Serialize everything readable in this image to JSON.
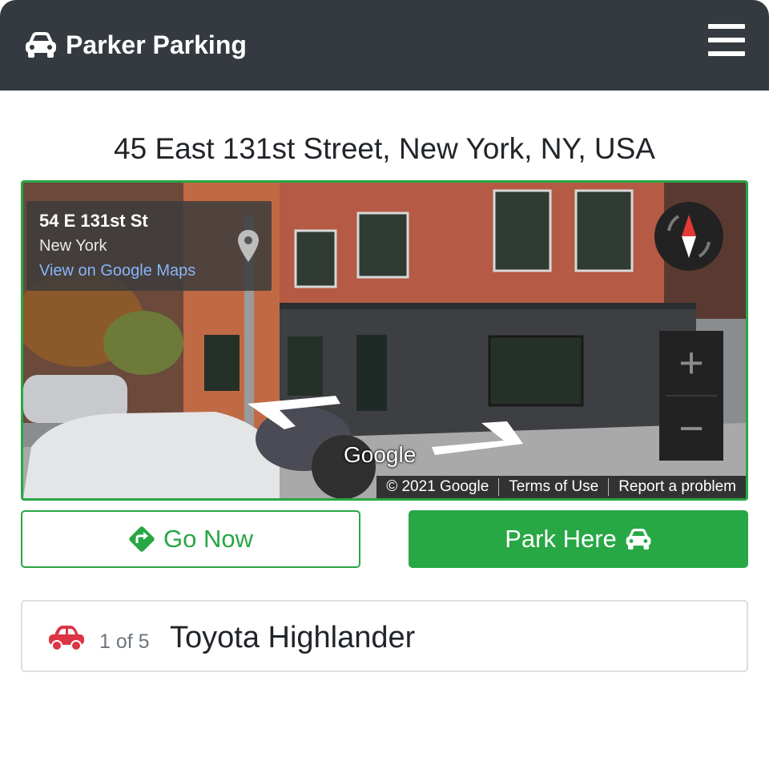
{
  "navbar": {
    "brand": "Parker Parking",
    "brand_icon": "car-icon",
    "menu_icon": "hamburger-icon",
    "background": "#343a40"
  },
  "location": {
    "address": "45 East 131st Street, New York, NY, USA"
  },
  "street_view": {
    "place_name": "54 E 131st St",
    "place_city": "New York",
    "maps_link": "View on Google Maps",
    "logo": "Google",
    "copyright": "© 2021 Google",
    "terms": "Terms of Use",
    "report": "Report a problem",
    "zoom_in": "+",
    "zoom_out": "−"
  },
  "actions": {
    "go_now": "Go Now",
    "park_here": "Park Here",
    "accent": "#28a745"
  },
  "vehicle": {
    "count": "1 of 5",
    "name": "Toyota Highlander",
    "icon_color": "#dc3545"
  }
}
